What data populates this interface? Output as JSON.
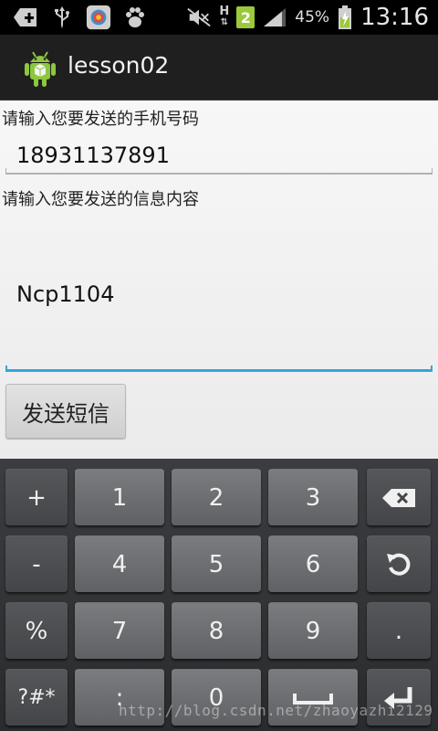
{
  "status_bar": {
    "icons": [
      "add-notification-icon",
      "usb-icon",
      "browser-icon",
      "paw-icon",
      "mute-icon",
      "hplus-data-icon",
      "sim-badge-icon",
      "signal-icon",
      "battery-icon"
    ],
    "network_type": "H",
    "sim_badge": "2",
    "battery_percent": "45%",
    "time": "13:16"
  },
  "action_bar": {
    "title": "lesson02",
    "icon": "android-icon"
  },
  "form": {
    "phone_label": "请输入您要发送的手机号码",
    "phone_value": "18931137891",
    "message_label": "请输入您要发送的信息内容",
    "message_value": "Ncp1104",
    "send_label": "发送短信"
  },
  "keyboard": {
    "rows": [
      [
        "+",
        "1",
        "2",
        "3",
        "backspace"
      ],
      [
        "-",
        "4",
        "5",
        "6",
        "undo"
      ],
      [
        "%",
        "7",
        "8",
        "9",
        "."
      ],
      [
        "?#*",
        ":",
        "0",
        "space",
        "enter"
      ]
    ],
    "labels": {
      "plus": "+",
      "one": "1",
      "two": "2",
      "three": "3",
      "minus": "-",
      "four": "4",
      "five": "5",
      "six": "6",
      "percent": "%",
      "seven": "7",
      "eight": "8",
      "nine": "9",
      "dot": ".",
      "symbols": "?#*",
      "colon": ":",
      "zero": "0"
    }
  },
  "watermark": "http://blog.csdn.net/zhaoyazhi2129",
  "colors": {
    "focus_underline": "#33a6d8",
    "sim_badge": "#9bc93a",
    "battery_fill": "#9bc93a"
  }
}
